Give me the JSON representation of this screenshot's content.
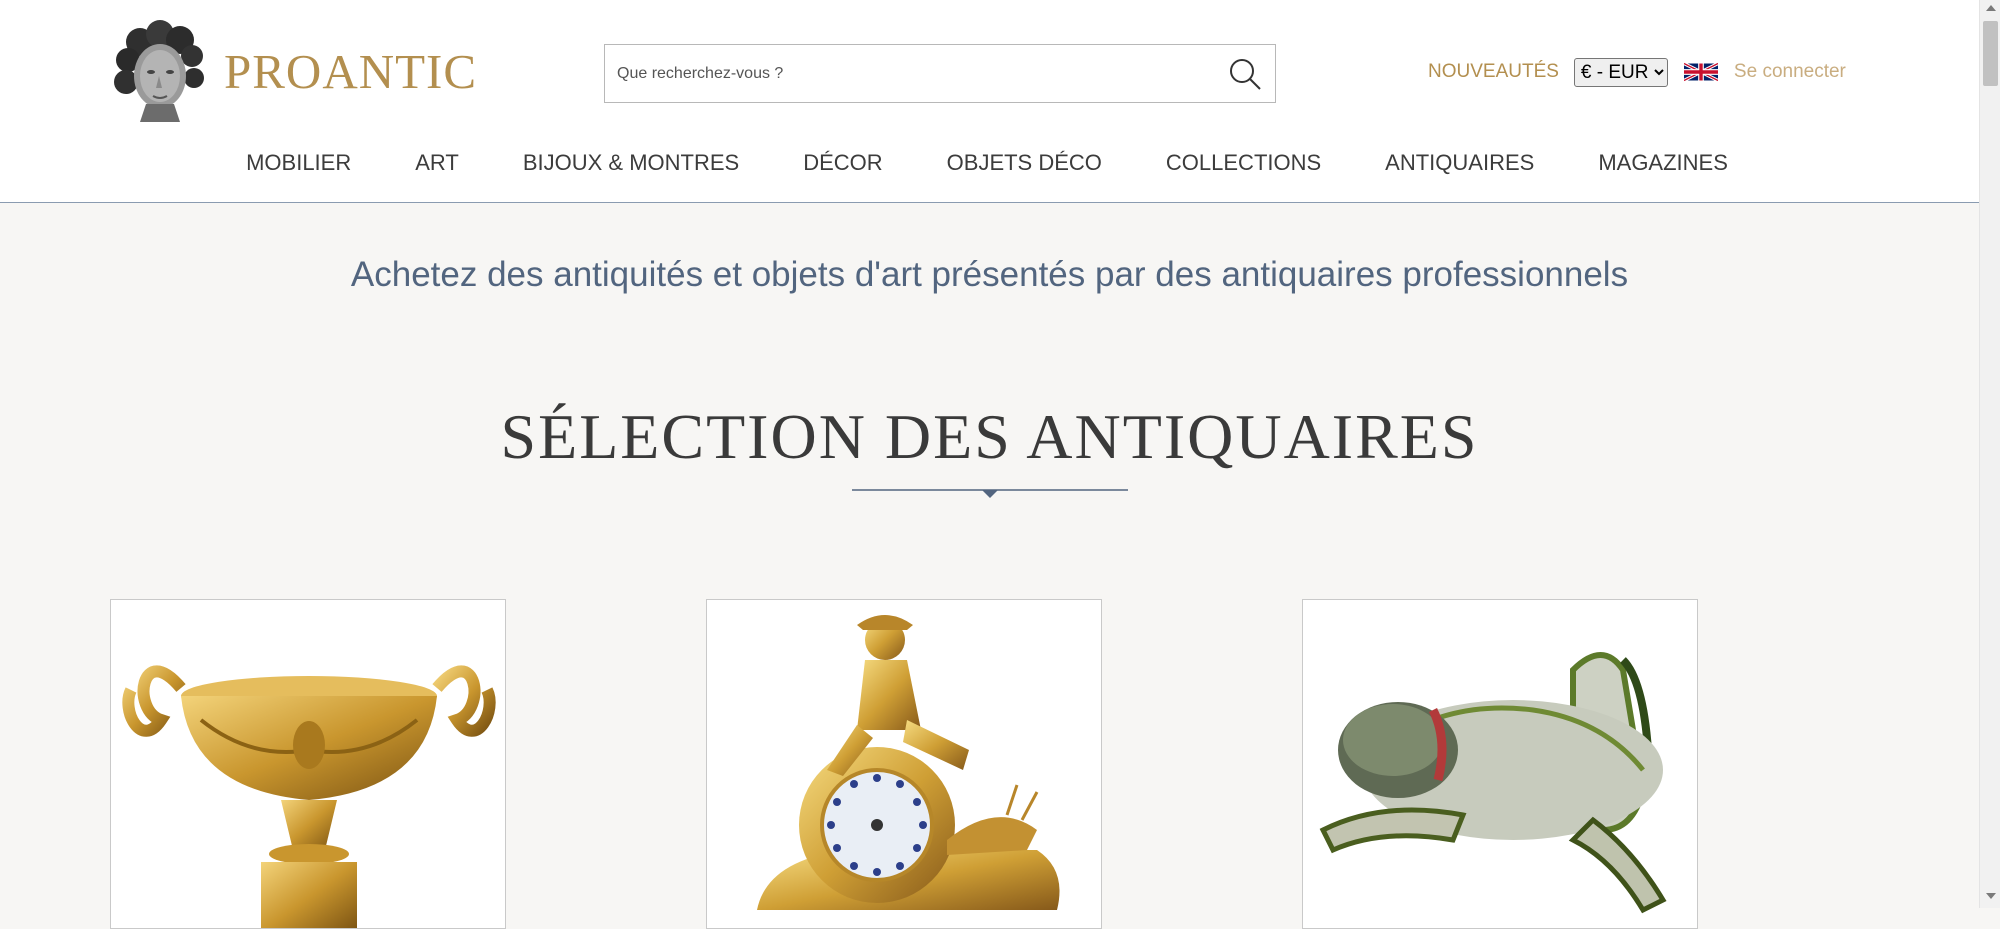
{
  "brand": {
    "name": "PROANTIC",
    "accent_color": "#b38f4f"
  },
  "search": {
    "placeholder": "Que recherchez-vous ?",
    "value": ""
  },
  "header": {
    "nouveautes_label": "NOUVEAUTÉS",
    "currency": {
      "selected": "€ - EUR",
      "options": [
        "€ - EUR"
      ]
    },
    "language_flag": "uk-flag-icon",
    "login_label": "Se connecter"
  },
  "nav": {
    "items": [
      {
        "label": "MOBILIER"
      },
      {
        "label": "ART"
      },
      {
        "label": "BIJOUX & MONTRES"
      },
      {
        "label": "DÉCOR"
      },
      {
        "label": "OBJETS DÉCO"
      },
      {
        "label": "COLLECTIONS"
      },
      {
        "label": "ANTIQUAIRES"
      },
      {
        "label": "MAGAZINES"
      }
    ]
  },
  "main": {
    "tagline": "Achetez des antiquités et objets d'art présentés par des antiquaires professionnels",
    "section_title": "SÉLECTION DES ANTIQUAIRES",
    "products": [
      {
        "image": "gilt-bronze-urn-image"
      },
      {
        "image": "gilt-bronze-clock-image"
      },
      {
        "image": "painted-frog-sculpture-image"
      }
    ]
  }
}
